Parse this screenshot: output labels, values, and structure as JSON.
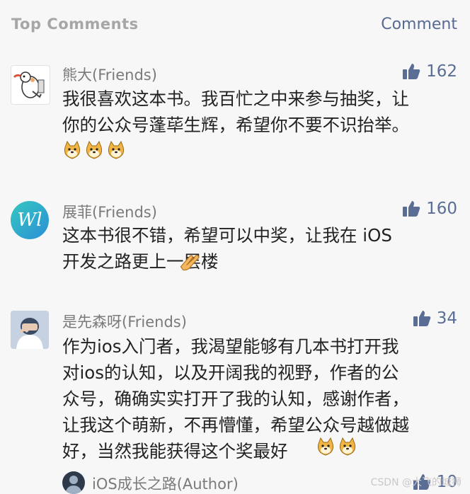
{
  "header": {
    "title": "Top Comments",
    "action": "Comment"
  },
  "comments": [
    {
      "name": "熊大(Friends)",
      "likes": "162",
      "body": "我很喜欢这本书。我百忙之中来参与抽奖，让\n你的公众号蓬荜生辉，希望你不要不识抬举。",
      "emojis": [
        "doge-emoji",
        "doge-emoji",
        "doge-emoji"
      ]
    },
    {
      "name": "展菲(Friends)",
      "likes": "160",
      "avatar_text": "Wl",
      "body": "这本书很不错，希望可以中奖，让我在 iOS\n开发之路更上一层楼",
      "emojis": [
        "clap-emoji"
      ]
    },
    {
      "name": "是先森呀(Friends)",
      "likes": "34",
      "body": "作为ios入门者，我渴望能够有几本书打开我\n对ios的认知，以及开阔我的视野，作者的公\n众号，确确实实打开了我的认知，感谢作者，\n让我这个萌新，不再懵懂，希望公众号越做越\n好，当然我能获得这个奖最好",
      "emojis": [
        "doge-emoji",
        "doge-emoji"
      ]
    },
    {
      "name": "iOS成长之路(Author)",
      "likes": "10"
    }
  ],
  "watermark": "CSDN @大飞的城狮",
  "colors": {
    "accent": "#586a93",
    "name": "#7a7a7a",
    "text": "#222222",
    "background": "#f7f7f7"
  }
}
